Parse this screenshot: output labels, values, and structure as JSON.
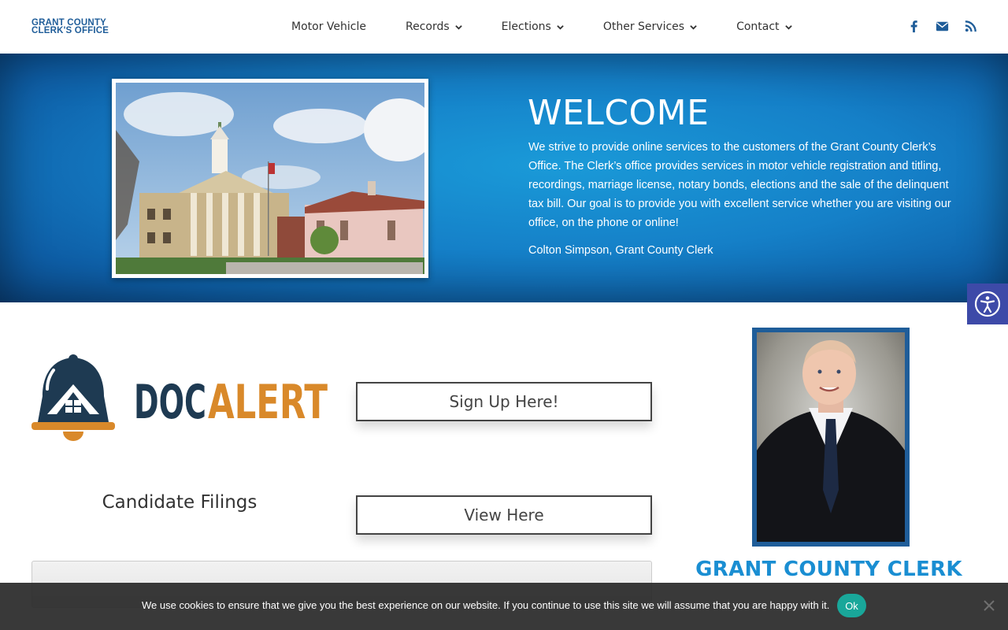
{
  "header": {
    "logo_line1": "GRANT COUNTY",
    "logo_line2": "CLERK'S OFFICE",
    "nav": [
      {
        "label": "Motor Vehicle",
        "has_dropdown": false
      },
      {
        "label": "Records",
        "has_dropdown": true
      },
      {
        "label": "Elections",
        "has_dropdown": true
      },
      {
        "label": "Other Services",
        "has_dropdown": true
      },
      {
        "label": "Contact",
        "has_dropdown": true
      }
    ],
    "social_icons": [
      "facebook-icon",
      "email-icon",
      "rss-icon"
    ]
  },
  "hero": {
    "title": "WELCOME",
    "body": "We strive to provide online services to the customers of the Grant County Clerk’s Office. The Clerk’s office provides services in motor vehicle registration and titling, recordings, marriage license, notary bonds, elections and the sale of the delinquent tax bill. Our goal is to provide you with excellent service whether you are visiting our office, on the phone or online!",
    "signature": "Colton Simpson, Grant County Clerk"
  },
  "docalert": {
    "part1": "DOC",
    "part2": "ALERT"
  },
  "signup_button": "Sign Up Here!",
  "candidate_filings": "Candidate Filings",
  "view_button": "View Here",
  "clerk_title": "GRANT COUNTY CLERK",
  "cookie": {
    "text": "We use cookies to ensure that we give you the best experience on our website. If you continue to use this site we will assume that you are happy with it.",
    "ok": "Ok"
  },
  "colors": {
    "brand_blue": "#1f5d99",
    "accent_blue": "#1a8ed2",
    "doc_navy": "#1e3a52",
    "alert_orange": "#d9892a",
    "cookie_ok": "#19a79a",
    "a11y": "#3d4aa8"
  }
}
